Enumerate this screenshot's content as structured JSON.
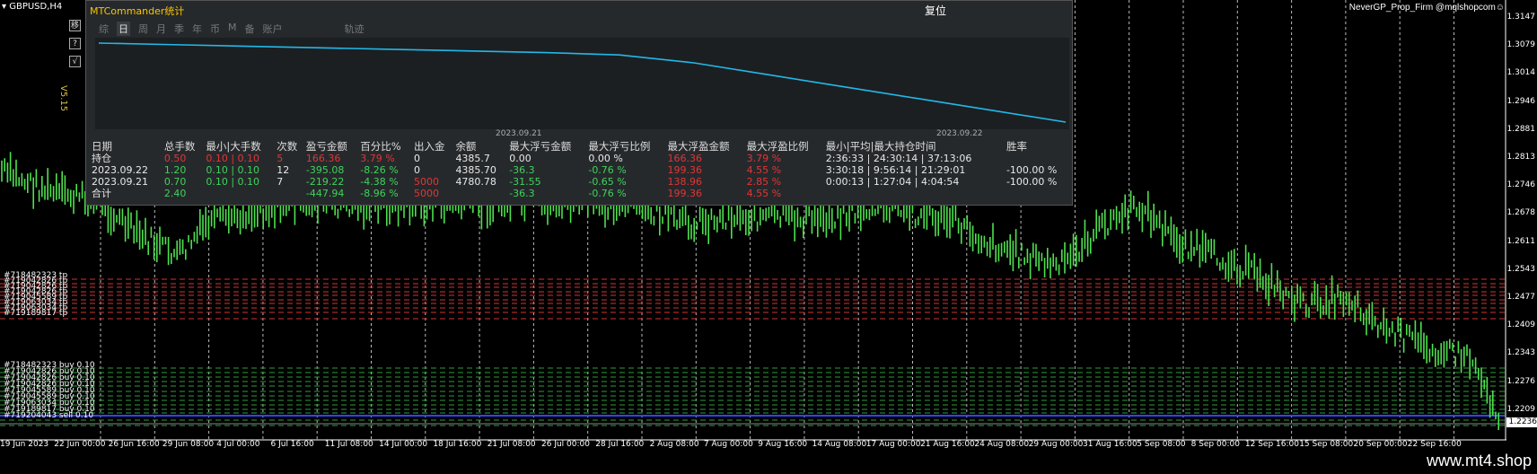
{
  "symbol": "GBPUSD,H4",
  "top_right_label": "NeverGP_Prop_Firm @mqlshopcom☺",
  "version": "V5.15",
  "side_buttons": [
    "移",
    "?",
    "√"
  ],
  "price_ticks": [
    "1.3147",
    "1.3079",
    "1.3014",
    "1.2946",
    "1.2881",
    "1.2813",
    "1.2746",
    "1.2678",
    "1.2611",
    "1.2543",
    "1.2477",
    "1.2409",
    "1.2343",
    "1.2276",
    "1.2209"
  ],
  "current_price": "1.2236",
  "date_ticks": [
    "19 Jun 2023",
    "22 Jun 00:00",
    "26 Jun 16:00",
    "29 Jun 08:00",
    "4 Jul 00:00",
    "6 Jul 16:00",
    "11 Jul 08:00",
    "14 Jul 00:00",
    "18 Jul 16:00",
    "21 Jul 08:00",
    "26 Jul 00:00",
    "28 Jul 16:00",
    "2 Aug 08:00",
    "7 Aug 00:00",
    "9 Aug 16:00",
    "14 Aug 08:00",
    "17 Aug 00:00",
    "21 Aug 16:00",
    "24 Aug 08:00",
    "29 Aug 00:00",
    "31 Aug 16:00",
    "5 Sep 08:00",
    "8 Sep 00:00",
    "12 Sep 16:00",
    "15 Sep 08:00",
    "20 Sep 00:00",
    "22 Sep 16:00"
  ],
  "watermark": "www.mt4.shop",
  "order_labels_red": [
    "#718482323 tp",
    "#719042826 tp",
    "#719042826 tp",
    "#719042826 tp",
    "#719045589 tp",
    "#719063034 tp",
    "#719063034 tp",
    "#719189817 tp"
  ],
  "order_labels_green": [
    "#718482323 buy 0.10",
    "#719042826 buy 0.10",
    "#719042826 buy 0.10",
    "#719042826 buy 0.10",
    "#719045589 buy 0.10",
    "#719045589 buy 0.10",
    "#719063034 buy 0.10",
    "#719189817 buy 0.10",
    "#719204043 sell 0.10"
  ],
  "panel": {
    "title": "MTCommander统计",
    "restore": "复位",
    "tabs": [
      "综",
      "日",
      "周",
      "月",
      "季",
      "年",
      "币",
      "M",
      "备",
      "账户",
      "轨迹"
    ],
    "active_tab": "日",
    "equity_dates": [
      "2023.09.21",
      "2023.09.22"
    ],
    "equity_values": [
      100,
      98,
      96,
      94,
      92,
      90,
      88,
      85,
      75,
      60,
      45,
      30,
      15,
      0
    ],
    "headers": [
      "日期",
      "总手数",
      "最小|大手数",
      "次数",
      "盈亏金额",
      "百分比%",
      "出入金",
      "余额",
      "最大浮亏金额",
      "最大浮亏比例",
      "最大浮盈金额",
      "最大浮盈比例",
      "最小|平均|最大持仓时间",
      "胜率"
    ],
    "rows": [
      {
        "cells": [
          "持仓",
          "0.50",
          "0.10 | 0.10",
          "5",
          "166.36",
          "3.79 %",
          "0",
          "4385.7",
          "0.00",
          "0.00 %",
          "166.36",
          "3.79 %",
          "2:36:33 | 24:30:14 | 37:13:06",
          ""
        ],
        "colors": [
          "white",
          "red",
          "red",
          "red",
          "red",
          "red",
          "white",
          "white",
          "white",
          "white",
          "red",
          "red",
          "white",
          "white"
        ]
      },
      {
        "cells": [
          "2023.09.22",
          "1.20",
          "0.10 | 0.10",
          "12",
          "-395.08",
          "-8.26 %",
          "0",
          "4385.70",
          "-36.3",
          "-0.76 %",
          "199.36",
          "4.55 %",
          "3:30:18 | 9:56:14 | 21:29:01",
          "-100.00 %"
        ],
        "colors": [
          "white",
          "green",
          "green",
          "white",
          "green",
          "green",
          "white",
          "white",
          "green",
          "green",
          "red",
          "red",
          "white",
          "white"
        ]
      },
      {
        "cells": [
          "2023.09.21",
          "0.70",
          "0.10 | 0.10",
          "7",
          "-219.22",
          "-4.38 %",
          "5000",
          "4780.78",
          "-31.55",
          "-0.65 %",
          "138.96",
          "2.85 %",
          "0:00:13 | 1:27:04 | 4:04:54",
          "-100.00 %"
        ],
        "colors": [
          "white",
          "green",
          "green",
          "white",
          "green",
          "green",
          "red",
          "white",
          "green",
          "green",
          "red",
          "red",
          "white",
          "white"
        ]
      },
      {
        "cells": [
          "合计",
          "2.40",
          "",
          "",
          "-447.94",
          "-8.96 %",
          "5000",
          "",
          "-36.3",
          "-0.76 %",
          "199.36",
          "4.55 %",
          "",
          ""
        ],
        "colors": [
          "white",
          "green",
          "white",
          "white",
          "green",
          "green",
          "red",
          "white",
          "green",
          "green",
          "red",
          "red",
          "white",
          "white"
        ]
      }
    ]
  }
}
